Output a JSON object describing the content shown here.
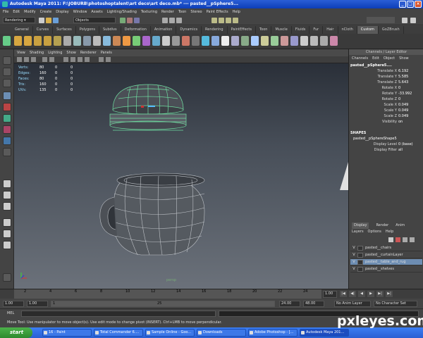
{
  "window": {
    "title": "Autodesk Maya 2011: F:\\JOBURB\\photoshoptalent\\art deco\\art deco.mb*   ---   pasted__pSphere5..."
  },
  "menus": [
    "File",
    "Edit",
    "Modify",
    "Create",
    "Display",
    "Window",
    "Assets",
    "Lighting/Shading",
    "Texturing",
    "Render",
    "Toon",
    "Stereo",
    "Paint Effects",
    "Help"
  ],
  "status": {
    "mode": "Rendering",
    "objects": "Objects"
  },
  "shelf_tabs": [
    {
      "label": "General",
      "active": false
    },
    {
      "label": "Curves",
      "active": false
    },
    {
      "label": "Surfaces",
      "active": false
    },
    {
      "label": "Polygons",
      "active": false
    },
    {
      "label": "Subdivs",
      "active": false
    },
    {
      "label": "Deformation",
      "active": false
    },
    {
      "label": "Animation",
      "active": false
    },
    {
      "label": "Dynamics",
      "active": false
    },
    {
      "label": "Rendering",
      "active": false
    },
    {
      "label": "PaintEffects",
      "active": false
    },
    {
      "label": "Toon",
      "active": false
    },
    {
      "label": "Muscle",
      "active": false
    },
    {
      "label": "Fluids",
      "active": false
    },
    {
      "label": "Fur",
      "active": false
    },
    {
      "label": "Hair",
      "active": false
    },
    {
      "label": "nCloth",
      "active": false
    },
    {
      "label": "Custom",
      "active": true
    },
    {
      "label": "GoZBrush",
      "active": false
    }
  ],
  "viewport": {
    "menus": [
      "View",
      "Shading",
      "Lighting",
      "Show",
      "Renderer",
      "Panels"
    ],
    "hud": [
      {
        "label": "Verts:",
        "values": [
          "80",
          "0",
          "0"
        ]
      },
      {
        "label": "Edges:",
        "values": [
          "160",
          "0",
          "0"
        ]
      },
      {
        "label": "Faces:",
        "values": [
          "80",
          "0",
          "0"
        ]
      },
      {
        "label": "Tris:",
        "values": [
          "160",
          "0",
          "0"
        ]
      },
      {
        "label": "UVs:",
        "values": [
          "135",
          "0",
          "0"
        ]
      }
    ],
    "camera": "persp"
  },
  "channel_box": {
    "title": "Channels / Layer Editor",
    "menus": [
      "Channels",
      "Edit",
      "Object",
      "Show"
    ],
    "object": "pasted__pSphere5....",
    "attributes": [
      {
        "name": "Translate X",
        "value": "6.192"
      },
      {
        "name": "Translate Y",
        "value": "5.585"
      },
      {
        "name": "Translate Z",
        "value": "5.643"
      },
      {
        "name": "Rotate X",
        "value": "0"
      },
      {
        "name": "Rotate Y",
        "value": "-33.992"
      },
      {
        "name": "Rotate Z",
        "value": "0"
      },
      {
        "name": "Scale X",
        "value": "0.049"
      },
      {
        "name": "Scale Y",
        "value": "0.049"
      },
      {
        "name": "Scale Z",
        "value": "0.049"
      },
      {
        "name": "Visibility",
        "value": "on"
      }
    ],
    "shapes_label": "SHAPES",
    "shape_name": "pasted__pSphereShape5",
    "shape_attributes": [
      {
        "name": "Display Level",
        "value": "0 (base)"
      },
      {
        "name": "Display Filter",
        "value": "all"
      }
    ]
  },
  "layer_editor": {
    "tabs": [
      {
        "label": "Display",
        "active": true
      },
      {
        "label": "Render",
        "active": false
      },
      {
        "label": "Anim",
        "active": false
      }
    ],
    "menus": [
      "Layers",
      "Options",
      "Help"
    ],
    "layers": [
      {
        "v": "V",
        "name": "pasted__chairs",
        "selected": false
      },
      {
        "v": "V",
        "name": "pasted__curtainLayer",
        "selected": false
      },
      {
        "v": "V",
        "name": "pasted__table_and_rug",
        "selected": true
      },
      {
        "v": "V",
        "name": "pasted__shelves",
        "selected": false
      }
    ]
  },
  "timeline": {
    "ticks": [
      "2",
      "4",
      "6",
      "8",
      "10",
      "12",
      "14",
      "16",
      "18",
      "20",
      "22",
      "24"
    ],
    "current": "1.00",
    "playback": [
      "|◀",
      "◀|",
      "◀",
      "▶",
      "▶|",
      "▶|"
    ]
  },
  "range": {
    "start": "1.00",
    "playhead": "1.00",
    "slider_min": "1",
    "slider_max": "25",
    "end": "24.00",
    "anim_end": "48.00",
    "anim_layer": "No Anim Layer",
    "char_set": "No Character Set"
  },
  "mel": {
    "label": "MEL"
  },
  "help": "Move Tool: Use manipulator to move object(s). Use edit mode to change pivot (INSERT). Ctrl+LMB to move perpendicular.",
  "taskbar": {
    "start": "start",
    "tasks": [
      {
        "label": "16 - Paint",
        "active": false
      },
      {
        "label": "Total Commander 6....",
        "active": false
      },
      {
        "label": "Sample Online - Goo...",
        "active": false
      },
      {
        "label": "Downloads",
        "active": false
      },
      {
        "label": "Adobe Photoshop - [...",
        " active": false
      },
      {
        "label": "Autodesk Maya 201...",
        "active": true
      }
    ]
  },
  "watermark": "pxleyes.com"
}
